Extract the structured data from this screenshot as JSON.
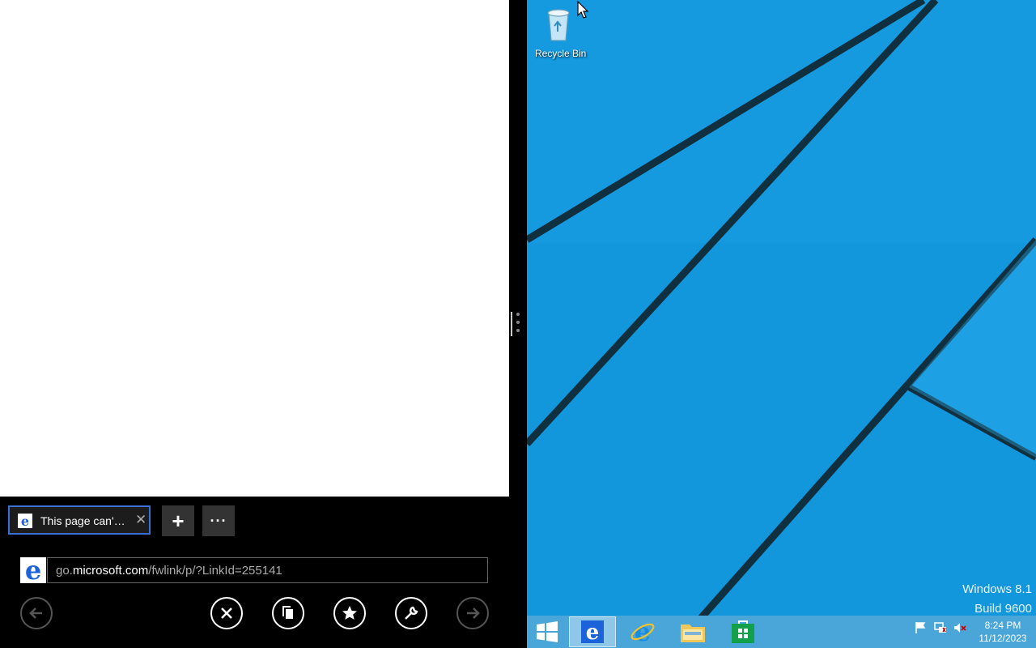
{
  "ie": {
    "tab_title": "This page can'…",
    "tab_close": "✕",
    "new_tab_label": "+",
    "tab_tools_label": "···",
    "address": {
      "prefix": "go.",
      "host": "microsoft.com",
      "path": "/fwlink/p/?LinkId=255141"
    },
    "buttons": [
      "back-icon",
      "stop-icon",
      "tabs-icon",
      "favorites-icon",
      "page-tools-icon",
      "forward-icon"
    ]
  },
  "desktop": {
    "recycle_bin_label": "Recycle Bin",
    "watermark_line1": "Windows 8.1",
    "watermark_line2": "Build 9600"
  },
  "taskbar": {
    "items": [
      "start-button",
      "ie-modern",
      "ie-desktop",
      "file-explorer",
      "store"
    ],
    "tray_icons": [
      "action-center-flag-icon",
      "network-icon",
      "volume-muted-icon"
    ],
    "clock_time": "8:24 PM",
    "clock_date": "11/12/2023"
  },
  "colors": {
    "desktop_blue": "#1297dd",
    "ie_blue": "#1c62d8",
    "taskbar": "#4aa6d8",
    "tab_border": "#3b6fd6"
  }
}
